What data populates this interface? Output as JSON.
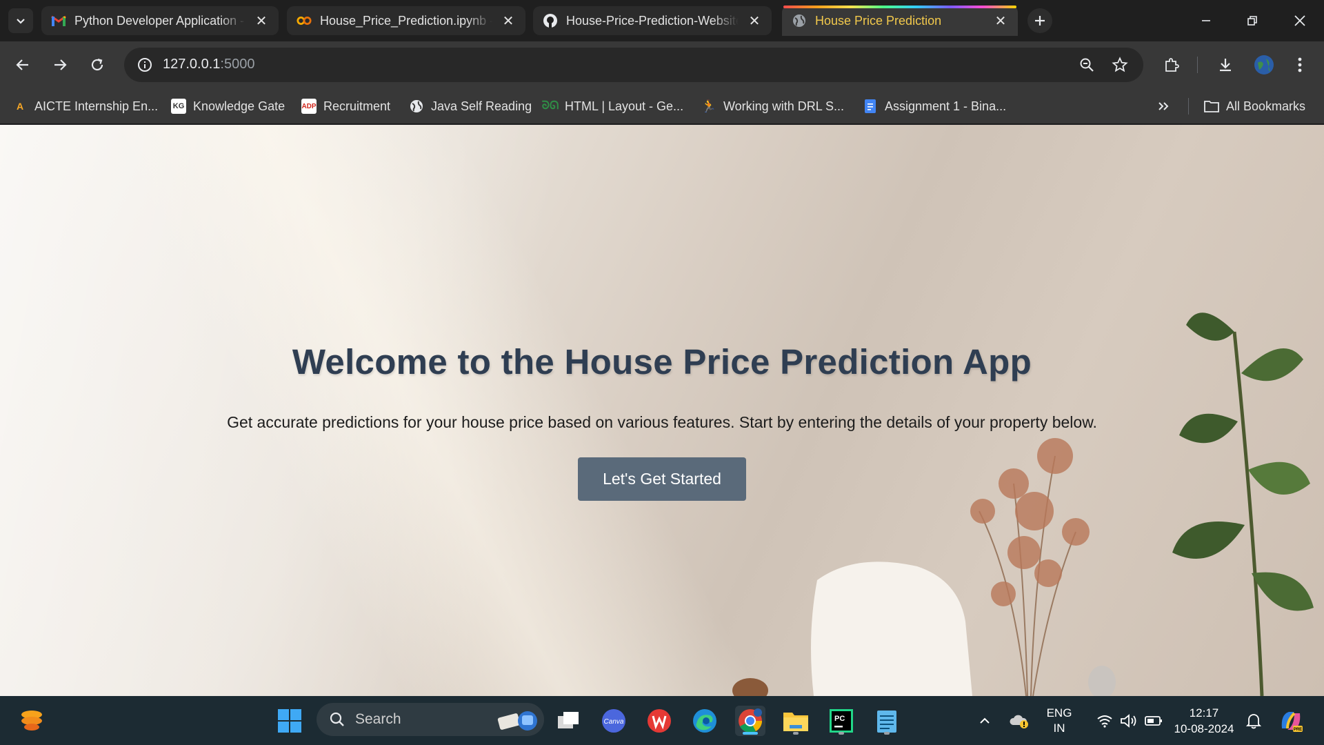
{
  "browser": {
    "tabs": [
      {
        "title": "Python Developer Application -",
        "favicon": "gmail-icon",
        "active": false
      },
      {
        "title": "House_Price_Prediction.ipynb -",
        "favicon": "colab-icon",
        "active": false
      },
      {
        "title": "House-Price-Prediction-Website",
        "favicon": "github-icon",
        "active": false
      },
      {
        "title": "House Price Prediction",
        "favicon": "globe-icon",
        "active": true
      }
    ],
    "url_host": "127.0.0.1",
    "url_port": ":5000"
  },
  "bookmarks": [
    {
      "label": "AICTE Internship En...",
      "icon": "aicte-icon"
    },
    {
      "label": "Knowledge Gate",
      "icon": "kg-icon"
    },
    {
      "label": "Recruitment",
      "icon": "adp-icon"
    },
    {
      "label": "Java Self Reading",
      "icon": "globe-icon"
    },
    {
      "label": "HTML | Layout - Ge...",
      "icon": "gfg-icon"
    },
    {
      "label": "Working with DRL S...",
      "icon": "runner-icon"
    },
    {
      "label": "Assignment 1 - Bina...",
      "icon": "docs-icon"
    }
  ],
  "all_bookmarks_label": "All Bookmarks",
  "hero": {
    "title": "Welcome to the House Price Prediction App",
    "subtitle": "Get accurate predictions for your house price based on various features. Start by entering the details of your property below.",
    "cta": "Let's Get Started"
  },
  "taskbar": {
    "search_label": "Search",
    "lang_line1": "ENG",
    "lang_line2": "IN",
    "time": "12:17",
    "date": "10-08-2024"
  },
  "colors": {
    "title": "#2f3e52",
    "button": "#5a6a7a",
    "active_tab_title": "#f2c94c",
    "taskbar": "#1c2b33"
  }
}
